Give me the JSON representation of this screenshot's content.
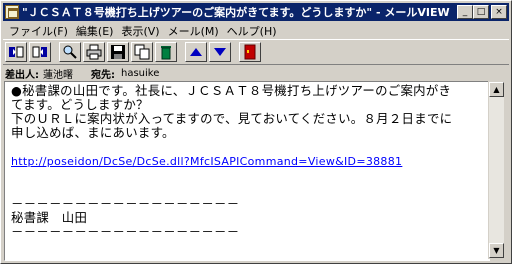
{
  "window": {
    "title": "\"ＪＣＳＡＴ８号機打ち上げツアーのご案内がきてます。どうしますか\" - メールVIEW",
    "buttons": {
      "minimize": "_",
      "maximize": "□",
      "close": "×"
    }
  },
  "menu": [
    "ファイル(F)",
    "編集(E)",
    "表示(V)",
    "メール(M)",
    "ヘルプ(H)"
  ],
  "toolbar": {
    "icons": [
      "prev-message-icon",
      "next-message-icon",
      "find-icon",
      "print-icon",
      "save-icon",
      "copy-icon",
      "delete-icon",
      "up-arrow-icon",
      "down-arrow-icon",
      "exit-icon"
    ]
  },
  "header": {
    "from_label": "差出人:",
    "from_value": "蓮池曙",
    "to_label": "宛先:",
    "to_value": "hasuike"
  },
  "message": {
    "line1": "●秘書課の山田です。社長に、ＪＣＳＡＴ８号機打ち上げツアーのご案内がき",
    "line2": "てます。どうしますか？",
    "line3": "下のＵＲＬに案内状が入ってますので、見ておいてください。８月２日までに",
    "line4": "申し込めば、まにあいます。",
    "link": "http://poseidon/DcSe/DcSe.dll?MfcISAPICommand=View&ID=38881",
    "divider1": "－－－－－－－－－－－－－－－－－－",
    "signature": "秘書課　山田",
    "divider2": "－－－－－－－－－－－－－－－－－－"
  },
  "colors": {
    "titlebar": "#0a246a",
    "face": "#d4d0c8",
    "link": "#0000ff"
  }
}
